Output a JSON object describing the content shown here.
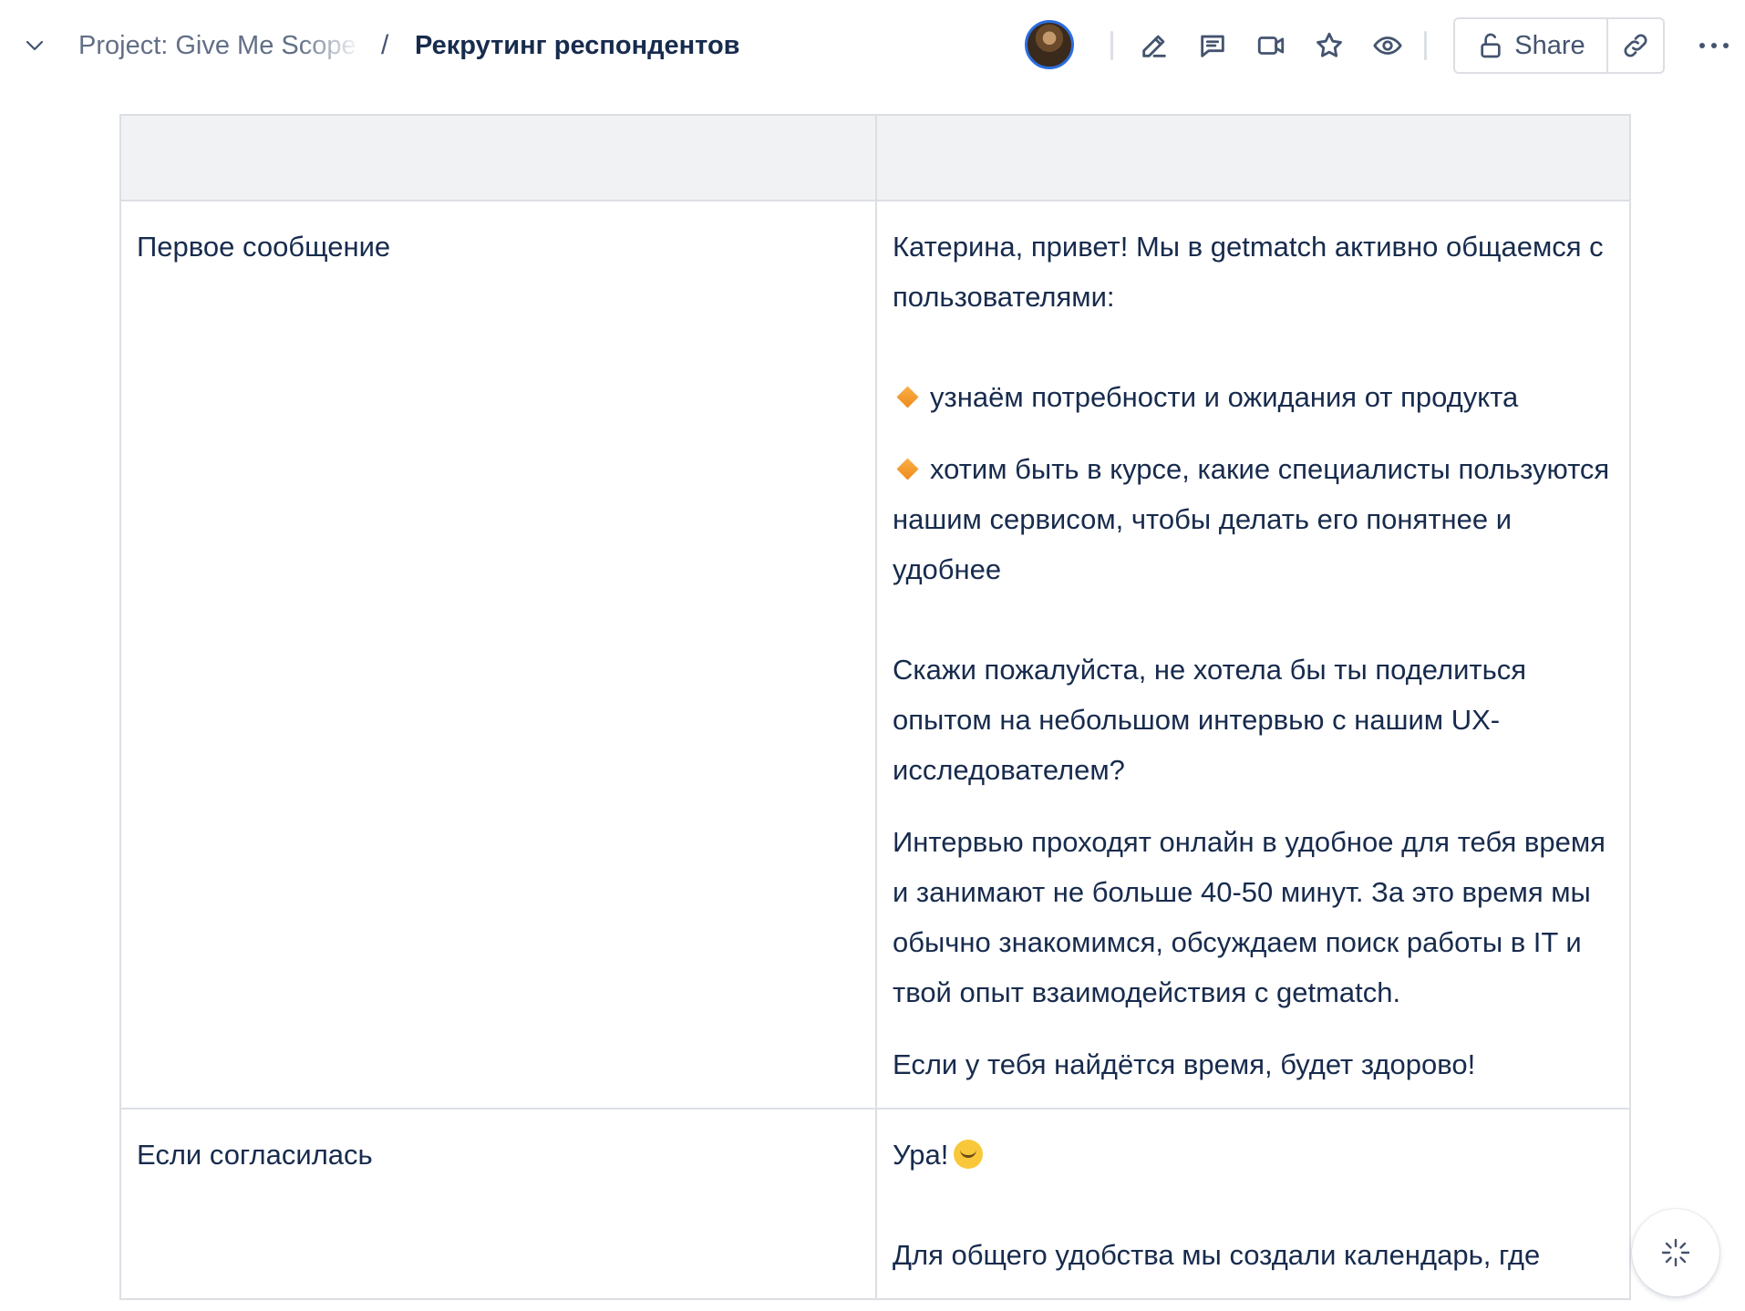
{
  "breadcrumb": {
    "project": "Project: Give Me Scope",
    "separator": "/",
    "current": "Рекрутинг респондентов"
  },
  "toolbar": {
    "share_label": "Share",
    "icons": [
      "edit-icon",
      "comment-icon",
      "video-icon",
      "star-icon",
      "eye-icon",
      "lock-open-icon",
      "link-icon",
      "more-icon"
    ]
  },
  "colors": {
    "accent": "#2b6de0",
    "text": "#172b4d",
    "muted": "#626f86",
    "border": "#dcdfe4",
    "header_bg": "#f1f2f4"
  },
  "table": {
    "rows": [
      {
        "label": "Первое сообщение",
        "paragraphs": [
          "Катерина, привет! Мы в getmatch активно общаемся с пользователями:",
          "узнаём потребности и ожидания от продукта",
          "хотим быть в курсе, какие специалисты пользуются нашим сервисом, чтобы делать его понятнее и удобнее",
          "Скажи пожалуйста, не хотела бы ты поделиться опытом на небольшом интервью с нашим UX-исследователем?",
          "Интервью проходят онлайн в удобное для тебя время и занимают не больше 40-50 минут. За это время мы обычно знакомимся, обсуждаем поиск работы в IT и твой опыт взаимодействия с getmatch.",
          "Если у тебя найдётся время, будет здорово!"
        ]
      },
      {
        "label": "Если согласилась",
        "paragraphs": [
          "Ура!",
          "Для общего удобства мы создали календарь, где"
        ]
      }
    ]
  }
}
